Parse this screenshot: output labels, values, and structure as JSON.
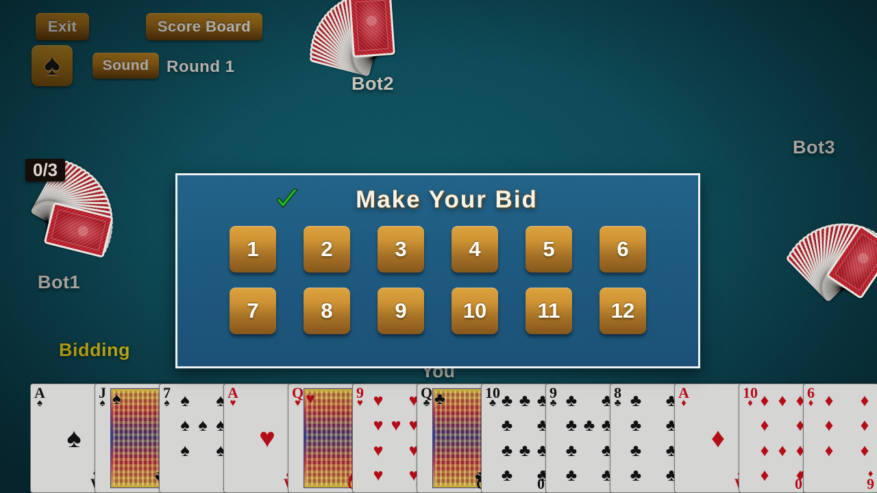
{
  "toolbar": {
    "exit_label": "Exit",
    "scoreboard_label": "Score Board",
    "sound_label": "Sound",
    "round_label": "Round 1",
    "suit_icon": "spade-icon",
    "suit_glyph": "♠"
  },
  "players": {
    "bot1": {
      "name": "Bot1",
      "tricks_badge": "0/3",
      "status": "Bidding"
    },
    "bot2": {
      "name": "Bot2"
    },
    "bot3": {
      "name": "Bot3"
    },
    "you": {
      "name": "You"
    }
  },
  "dialog": {
    "title": "Make  Your  Bid",
    "check_icon": "check-icon",
    "bids": [
      "1",
      "2",
      "3",
      "4",
      "5",
      "6",
      "7",
      "8",
      "9",
      "10",
      "11",
      "12"
    ]
  },
  "hand": {
    "cards": [
      {
        "rank": "A",
        "suit": "♠",
        "color": "black",
        "kind": "ace"
      },
      {
        "rank": "J",
        "suit": "♠",
        "color": "black",
        "kind": "face"
      },
      {
        "rank": "7",
        "suit": "♠",
        "color": "black",
        "kind": "pip"
      },
      {
        "rank": "A",
        "suit": "♥",
        "color": "red",
        "kind": "ace"
      },
      {
        "rank": "Q",
        "suit": "♥",
        "color": "red",
        "kind": "face"
      },
      {
        "rank": "9",
        "suit": "♥",
        "color": "red",
        "kind": "pip"
      },
      {
        "rank": "Q",
        "suit": "♣",
        "color": "black",
        "kind": "face"
      },
      {
        "rank": "10",
        "suit": "♣",
        "color": "black",
        "kind": "pip"
      },
      {
        "rank": "9",
        "suit": "♣",
        "color": "black",
        "kind": "pip"
      },
      {
        "rank": "8",
        "suit": "♣",
        "color": "black",
        "kind": "pip"
      },
      {
        "rank": "A",
        "suit": "♦",
        "color": "red",
        "kind": "ace"
      },
      {
        "rank": "10",
        "suit": "♦",
        "color": "red",
        "kind": "pip"
      },
      {
        "rank": "6",
        "suit": "♦",
        "color": "red",
        "kind": "pip"
      }
    ]
  },
  "colors": {
    "felt": "#0b4450",
    "dialog_bg": "#1d5a80",
    "dialog_border": "#eef2f4",
    "gold_button": "#cf9434",
    "status_text": "#d6c41c",
    "check_green": "#22c022",
    "card_back_red": "#b62531"
  }
}
